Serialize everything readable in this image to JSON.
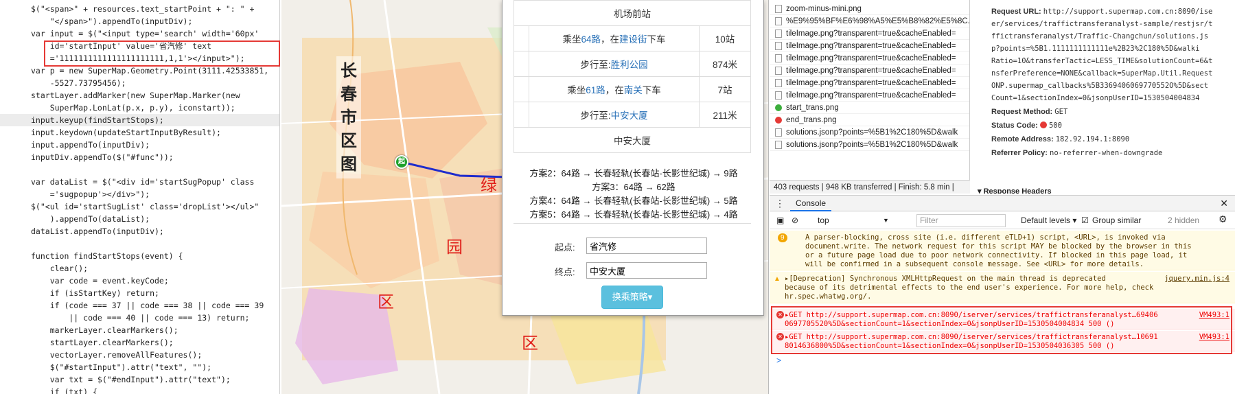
{
  "code": {
    "lines": [
      "$(\"<span>\" + resources.text_startPoint + \": \" +",
      "    \"</span>\").appendTo(inputDiv);",
      "var input = $(\"<input type='search' width='60px'",
      "    id='startInput' value='省汽修' text",
      "    ='1111111111111111111111,1,1'></input>\");",
      "var p = new SuperMap.Geometry.Point(3111.42533851,",
      "    -5527.73795456);",
      "startLayer.addMarker(new SuperMap.Marker(new",
      "    SuperMap.LonLat(p.x, p.y), iconstart));",
      "input.keyup(findStartStops);",
      "input.keydown(updateStartInputByResult);",
      "input.appendTo(inputDiv);",
      "inputDiv.appendTo($(\"#func\"));",
      "",
      "var dataList = $(\"<div id='startSugPopup' class",
      "    ='sugpopup'></div>\");",
      "$(\"<ul id='startSugList' class='dropList'></ul>\"",
      "    ).appendTo(dataList);",
      "dataList.appendTo(inputDiv);",
      "",
      "function findStartStops(event) {",
      "    clear();",
      "    var code = event.keyCode;",
      "    if (isStartKey) return;",
      "    if (code === 37 || code === 38 || code === 39",
      "        || code === 40 || code === 13) return;",
      "    markerLayer.clearMarkers();",
      "    startLayer.clearMarkers();",
      "    vectorLayer.removeAllFeatures();",
      "    $(\"#startInput\").attr(\"text\", \"\");",
      "    var txt = $(\"#endInput\").attr(\"text\");",
      "    if (txt) {"
    ]
  },
  "map": {
    "title": "长春市区图",
    "start_marker": "起",
    "districts": [
      "绿",
      "园",
      "区",
      "区"
    ]
  },
  "popup": {
    "route_rows": [
      {
        "text": "机场前站",
        "count": ""
      },
      {
        "pre": "乘坐",
        "link1": "64路",
        "mid": "，在",
        "link2": "建设街",
        "post": "下车",
        "count": "10站"
      },
      {
        "pre": "步行至:",
        "link1": "胜利公园",
        "mid": "",
        "link2": "",
        "post": "",
        "count": "874米"
      },
      {
        "pre": "乘坐",
        "link1": "61路",
        "mid": "，在",
        "link2": "南关",
        "post": "下车",
        "count": "7站"
      },
      {
        "pre": "步行至:",
        "link1": "中安大厦",
        "mid": "",
        "link2": "",
        "post": "",
        "count": "211米"
      },
      {
        "text": "中安大厦",
        "count": ""
      }
    ],
    "plans": [
      "方案2：64路 → 长春轻轨(长春站-长影世纪城) → 9路",
      "方案3：64路 → 62路",
      "方案4：64路 → 长春轻轨(长春站-长影世纪城) → 5路",
      "方案5：64路 → 长春轻轨(长春站-长影世纪城) → 4路"
    ],
    "start_label": "起点:",
    "start_value": "省汽修",
    "end_label": "终点:",
    "end_value": "中安大厦",
    "strategy_button": "换乘策略▾"
  },
  "network": {
    "rows": [
      {
        "name": "zoom-minus-mini.png",
        "icon": "file"
      },
      {
        "name": "%E9%95%BF%E6%98%A5%E5%B8%82%E5%8C...",
        "icon": "file"
      },
      {
        "name": "tileImage.png?transparent=true&cacheEnabled=",
        "icon": "file"
      },
      {
        "name": "tileImage.png?transparent=true&cacheEnabled=",
        "icon": "file"
      },
      {
        "name": "tileImage.png?transparent=true&cacheEnabled=",
        "icon": "file"
      },
      {
        "name": "tileImage.png?transparent=true&cacheEnabled=",
        "icon": "file"
      },
      {
        "name": "tileImage.png?transparent=true&cacheEnabled=",
        "icon": "file"
      },
      {
        "name": "tileImage.png?transparent=true&cacheEnabled=",
        "icon": "file"
      },
      {
        "name": "start_trans.png",
        "icon": "ok"
      },
      {
        "name": "end_trans.png",
        "icon": "err"
      },
      {
        "name": "solutions.jsonp?points=%5B1%2C180%5D&walk",
        "icon": "file"
      },
      {
        "name": "solutions.jsonp?points=%5B1%2C180%5D&walk",
        "icon": "file"
      }
    ],
    "summary": "403 requests  |  948 KB transferred  |  Finish: 5.8 min  |"
  },
  "headers": {
    "url_label": "Request URL:",
    "url_lines": [
      "http://support.supermap.com.cn:8090/ise",
      "er/services/traffictransferanalyst-sample/restjsr/t",
      "ffictransferanalyst/Traffic-Changchun/solutions.js",
      "p?points=%5B1.1111111111111e%2B23%2C180%5D&walki",
      "Ratio=10&transferTactic=LESS_TIME&solutionCount=6&t",
      "nsferPreference=NONE&callback=SuperMap.Util.Request",
      "ONP.supermap_callbacks%5B3369406069770552O%5D&sect",
      "Count=1&sectionIndex=0&jsonpUserID=1530504004834"
    ],
    "method_label": "Request Method:",
    "method": "GET",
    "status_label": "Status Code:",
    "status": "500",
    "remote_label": "Remote Address:",
    "remote": "182.92.194.1:8090",
    "referrer_label": "Referrer Policy:",
    "referrer": "no-referrer-when-downgrade",
    "response_headers": "▾ Response Headers"
  },
  "console": {
    "tab": "Console",
    "context": "top",
    "filter_placeholder": "Filter",
    "levels": "Default levels ▾",
    "group_similar": "Group similar",
    "hidden": "2 hidden",
    "warn1_badge": "9",
    "warn1": [
      "A parser-blocking, cross site (i.e. different eTLD+1) script, <URL>, is invoked via",
      "document.write. The network request for this script MAY be blocked by the browser in this",
      "or a future page load due to poor network connectivity. If blocked in this page load, it",
      "will be confirmed in a subsequent console message. See <URL> for more details."
    ],
    "warn2": [
      "▸[Deprecation] Synchronous XMLHttpRequest on the main thread is deprecated",
      "because of its detrimental effects to the end user's experience. For more help, check",
      "hr.spec.whatwg.org/."
    ],
    "warn2_src": "jquery.min.js:4",
    "warn2_link": "https://x",
    "err1": [
      "▸GET http://support.supermap.com.cn:8090/iserver/services/traffictransferanalyst…69406",
      "0697705520%5D&sectionCount=1&sectionIndex=0&jsonpUserID=1530504004834 500 ()"
    ],
    "err1_src": "VM493:1",
    "err2": [
      "▸GET http://support.supermap.com.cn:8090/iserver/services/traffictransferanalyst…10691",
      "8014636800%5D&sectionCount=1&sectionIndex=0&jsonpUserID=1530504036305 500 ()"
    ],
    "err2_src": "VM493:1",
    "prompt": ">"
  }
}
